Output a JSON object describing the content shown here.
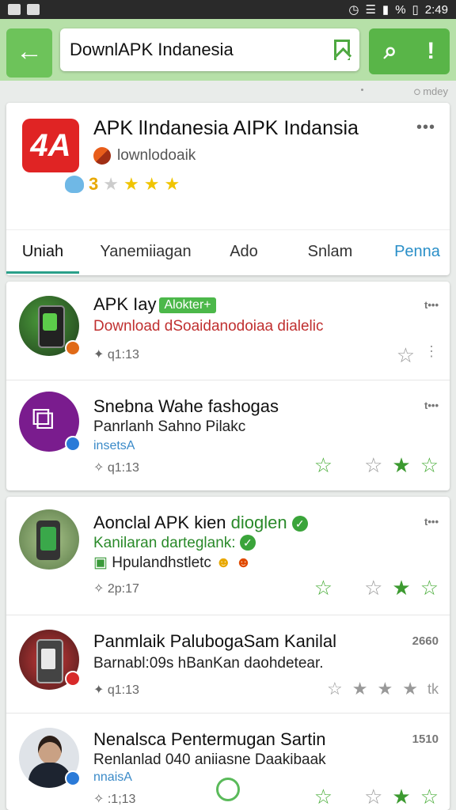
{
  "status": {
    "time": "2:49",
    "pct": "%"
  },
  "toolbar": {
    "back": "←",
    "query": "DownlAPK Indanesia",
    "search": "⌕",
    "alert": "!"
  },
  "top_note": "ഠ mdey",
  "app": {
    "logo": "4A",
    "title": "APK lIndanesia AIPK Indansia",
    "developer": "lownlodoaik",
    "rating": "3",
    "more": "•••"
  },
  "tabs": [
    "Uniah",
    "Yanemiiagan",
    "Ado",
    "Snlam",
    "Penna"
  ],
  "items": [
    {
      "title": "APK Iay",
      "tag": "Alokter+",
      "sub": "Download dSoaidanodoiaa dialelic",
      "meta": "q1:13",
      "right": "t•••"
    },
    {
      "title": "Snebna Wahe fashogas",
      "sub": "Panrlanh Sahno Pilakc",
      "sub2": "insetsA",
      "meta": "q1:13",
      "right": "t•••"
    },
    {
      "title": "Aonclal APK kien",
      "title_green": "dioglen",
      "sub": "Kanilaran darteglank:",
      "sub2": "Hpulandhstletc",
      "meta": "2p:17",
      "right": "t•••"
    },
    {
      "title": "Panmlaik PalubogaSam Kanilal",
      "sub": "Barnabl:09s hBanKan daohdetear.",
      "meta": "q1:13",
      "right": "2660",
      "right2": "tk"
    },
    {
      "title": "Nenalsca Pentermugan Sartin",
      "sub": "Renlanlad 040 aniiasne Daakibaak",
      "sub2": "nnaisA",
      "meta": ":1;13",
      "right": "1510"
    }
  ]
}
